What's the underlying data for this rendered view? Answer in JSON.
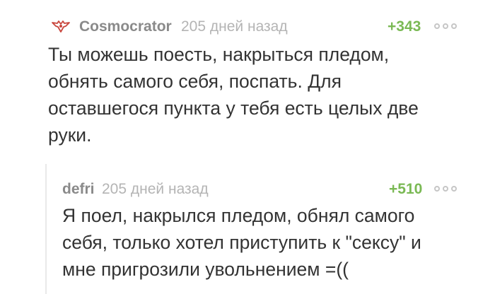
{
  "comments": [
    {
      "author": "Cosmocrator",
      "time": "205 дней назад",
      "rating": "+343",
      "avatar_icon": "winged-badge-icon",
      "text": "Ты можешь поесть, накрыться пледом,\nобнять самого себя, поспать. Для\nоставшегося пункта у тебя есть целых две\nруки."
    },
    {
      "author": "defri",
      "time": "205 дней назад",
      "rating": "+510",
      "text": "Я поел, накрылся пледом, обнял самого\nсебя, только хотел приступить к \"сексу\" и\nмне пригрозили увольнением =(("
    }
  ],
  "colors": {
    "rating": "#7ab954",
    "author": "#8a8a8a",
    "time": "#b4b4b4",
    "text": "#333333"
  }
}
